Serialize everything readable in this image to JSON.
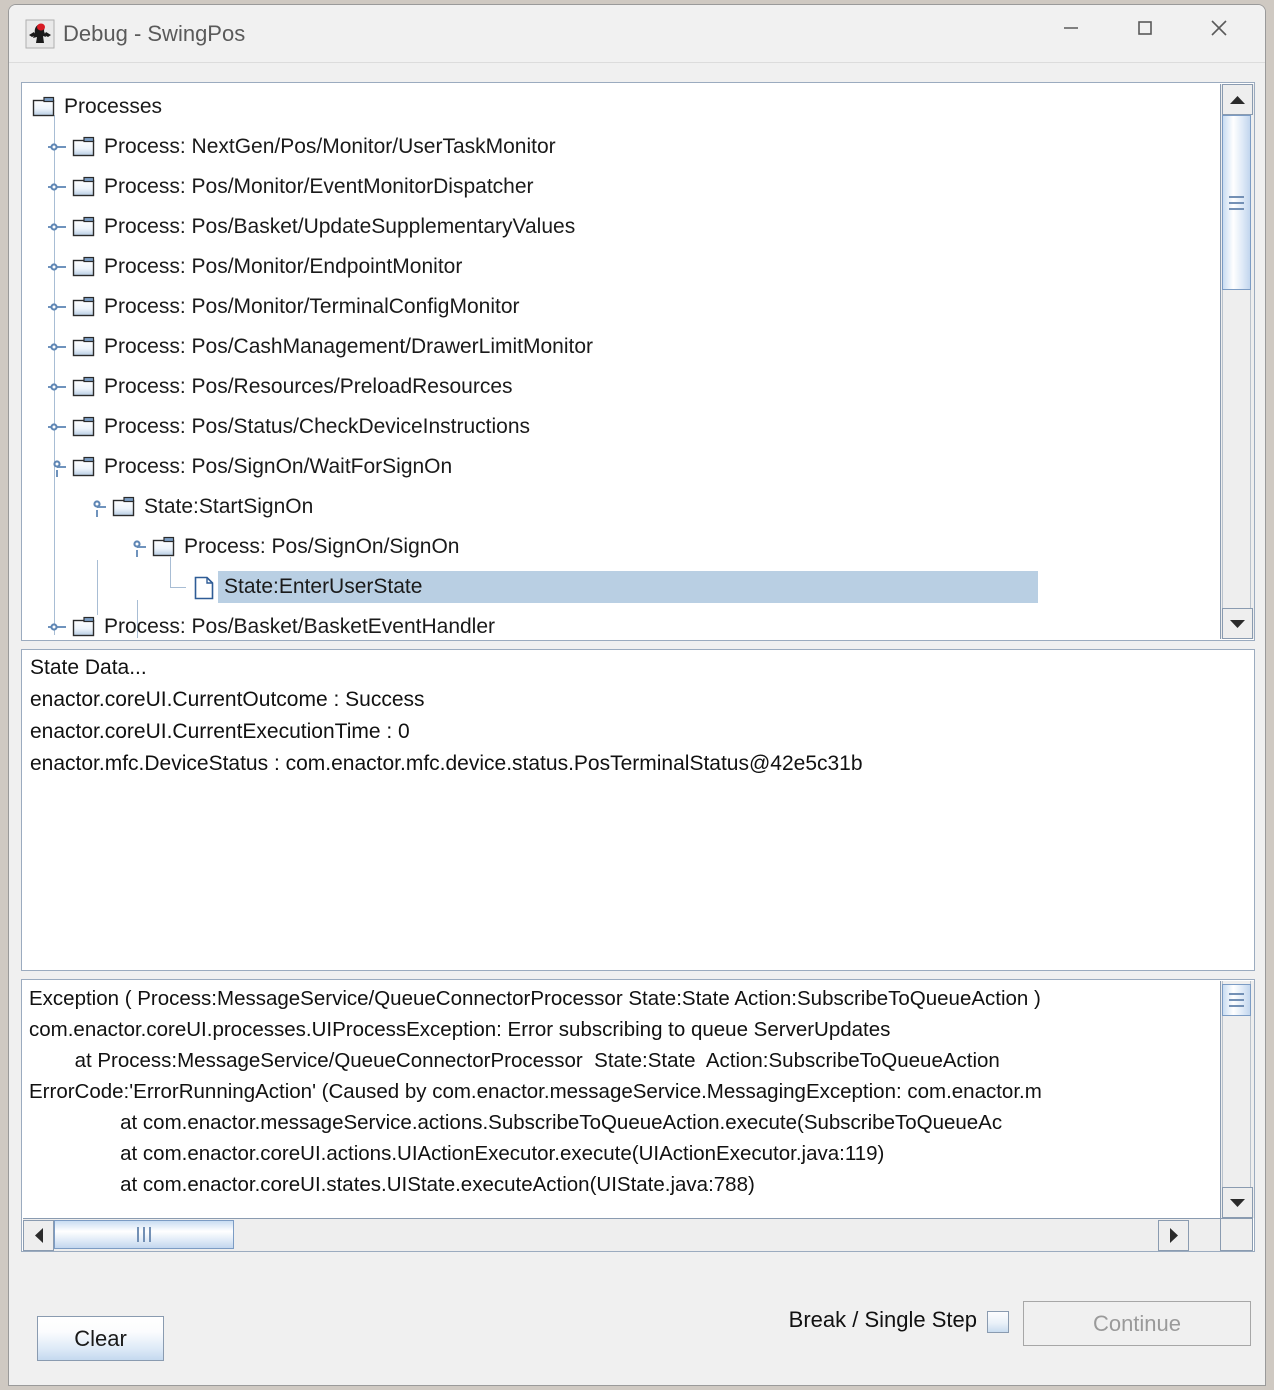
{
  "window": {
    "title": "Debug - SwingPos",
    "icon": "java-duke-icon",
    "controls": {
      "minimize": "minimize-button",
      "maximize": "maximize-button",
      "close": "close-button"
    }
  },
  "tree": {
    "root_label": "Processes",
    "nodes": [
      {
        "label": "Processes",
        "depth": 0,
        "type": "folder",
        "expanded": true,
        "handle": "none",
        "selected": false
      },
      {
        "label": "Process: NextGen/Pos/Monitor/UserTaskMonitor",
        "depth": 1,
        "type": "folder",
        "expanded": false,
        "handle": "collapsed",
        "selected": false
      },
      {
        "label": "Process: Pos/Monitor/EventMonitorDispatcher",
        "depth": 1,
        "type": "folder",
        "expanded": false,
        "handle": "collapsed",
        "selected": false
      },
      {
        "label": "Process: Pos/Basket/UpdateSupplementaryValues",
        "depth": 1,
        "type": "folder",
        "expanded": false,
        "handle": "collapsed",
        "selected": false
      },
      {
        "label": "Process: Pos/Monitor/EndpointMonitor",
        "depth": 1,
        "type": "folder",
        "expanded": false,
        "handle": "collapsed",
        "selected": false
      },
      {
        "label": "Process: Pos/Monitor/TerminalConfigMonitor",
        "depth": 1,
        "type": "folder",
        "expanded": false,
        "handle": "collapsed",
        "selected": false
      },
      {
        "label": "Process: Pos/CashManagement/DrawerLimitMonitor",
        "depth": 1,
        "type": "folder",
        "expanded": false,
        "handle": "collapsed",
        "selected": false
      },
      {
        "label": "Process: Pos/Resources/PreloadResources",
        "depth": 1,
        "type": "folder",
        "expanded": false,
        "handle": "collapsed",
        "selected": false
      },
      {
        "label": "Process: Pos/Status/CheckDeviceInstructions",
        "depth": 1,
        "type": "folder",
        "expanded": false,
        "handle": "collapsed",
        "selected": false
      },
      {
        "label": "Process: Pos/SignOn/WaitForSignOn",
        "depth": 1,
        "type": "folder",
        "expanded": true,
        "handle": "expanded",
        "selected": false
      },
      {
        "label": "State:StartSignOn",
        "depth": 2,
        "type": "folder",
        "expanded": true,
        "handle": "expanded",
        "selected": false
      },
      {
        "label": "Process: Pos/SignOn/SignOn",
        "depth": 3,
        "type": "folder",
        "expanded": true,
        "handle": "expanded",
        "selected": false
      },
      {
        "label": "State:EnterUserState",
        "depth": 4,
        "type": "leaf",
        "expanded": false,
        "handle": "none",
        "selected": true
      },
      {
        "label": "Process: Pos/Basket/BasketEventHandler",
        "depth": 1,
        "type": "folder",
        "expanded": false,
        "handle": "collapsed",
        "selected": false
      }
    ],
    "selection_color": "#b9cfe3"
  },
  "state_data": {
    "lines": [
      "State Data...",
      "enactor.coreUI.CurrentOutcome : Success",
      "enactor.coreUI.CurrentExecutionTime : 0",
      "enactor.mfc.DeviceStatus : com.enactor.mfc.device.status.PosTerminalStatus@42e5c31b"
    ]
  },
  "exception_log": {
    "lines": [
      "Exception ( Process:MessageService/QueueConnectorProcessor State:State Action:SubscribeToQueueAction )",
      "com.enactor.coreUI.processes.UIProcessException: Error subscribing to queue ServerUpdates",
      "        at Process:MessageService/QueueConnectorProcessor  State:State  Action:SubscribeToQueueAction",
      "ErrorCode:'ErrorRunningAction' (Caused by com.enactor.messageService.MessagingException: com.enactor.m",
      "                at com.enactor.messageService.actions.SubscribeToQueueAction.execute(SubscribeToQueueAc",
      "                at com.enactor.coreUI.actions.UIActionExecutor.execute(UIActionExecutor.java:119)",
      "                at com.enactor.coreUI.states.UIState.executeAction(UIState.java:788)"
    ]
  },
  "controls": {
    "break_single_step_label": "Break / Single Step",
    "break_single_step_checked": false,
    "continue_label": "Continue",
    "continue_enabled": false,
    "clear_label": "Clear"
  }
}
